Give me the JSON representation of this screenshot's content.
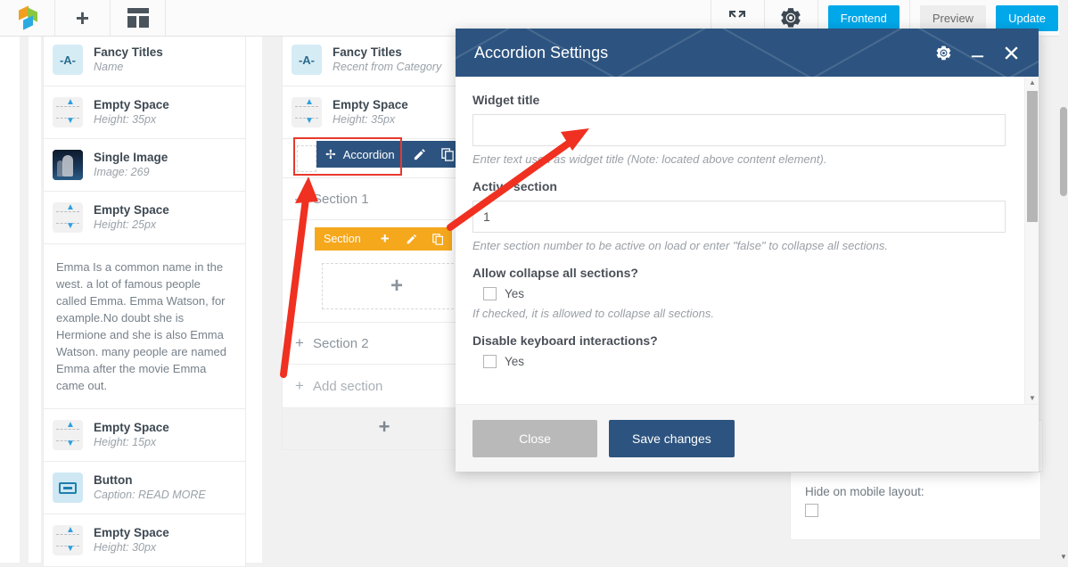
{
  "toolbar": {
    "logo_icon": "wpbakery-logo-icon",
    "add_element_icon": "plus-icon",
    "templates_icon": "layout-grid-icon",
    "fullscreen_icon": "expand-arrows-icon",
    "settings_icon": "gear-icon",
    "frontend_label": "Frontend",
    "preview_label": "Preview",
    "update_label": "Update",
    "accent_blue": "#00a8ea",
    "grey_button": "#ededed"
  },
  "left_column": {
    "elements": [
      {
        "icon": "fancy-titles-icon",
        "icon_text": "-A-",
        "title": "Fancy Titles",
        "subtitle": "Name"
      },
      {
        "icon": "empty-space-icon",
        "title": "Empty Space",
        "subtitle": "Height: 35px"
      },
      {
        "icon": "single-image-icon",
        "title": "Single Image",
        "subtitle": "Image: 269"
      },
      {
        "icon": "empty-space-icon",
        "title": "Empty Space",
        "subtitle": "Height: 25px"
      },
      {
        "icon": "text-block-icon",
        "title": "",
        "subtitle": "",
        "paragraph": "Emma Is a common name in the west. a lot of famous people called Emma. Emma Watson, for example.No doubt she is Hermione and she is also Emma Watson. many people are named Emma after the movie Emma came out."
      },
      {
        "icon": "empty-space-icon",
        "title": "Empty Space",
        "subtitle": "Height: 15px"
      },
      {
        "icon": "button-icon",
        "title": "Button",
        "subtitle": "Caption: READ MORE"
      },
      {
        "icon": "empty-space-icon",
        "title": "Empty Space",
        "subtitle": "Height: 30px"
      }
    ]
  },
  "middle_column": {
    "elements": [
      {
        "icon": "fancy-titles-icon",
        "icon_text": "-A-",
        "title": "Fancy Titles",
        "subtitle": "Recent from Category"
      },
      {
        "icon": "empty-space-icon",
        "title": "Empty Space",
        "subtitle": "Height: 35px"
      }
    ],
    "accordion": {
      "control_label": "Accordion",
      "move_icon": "move-arrows-icon",
      "edit_icon": "pencil-icon",
      "clone_icon": "copy-icon",
      "control_bar_color": "#2d5480",
      "highlight_color": "#e8392c",
      "section_1": {
        "toggle_sign": "—",
        "label": "Section 1",
        "control_label": "Section",
        "control_bar_color": "#f5a81c",
        "add_icon": "plus-icon",
        "edit_icon": "pencil-icon",
        "clone_icon": "copy-icon",
        "placeholder_icon": "plus-icon"
      },
      "section_2": {
        "toggle_sign": "+",
        "label": "Section 2"
      },
      "add_section": {
        "sign": "+",
        "label": "Add section"
      },
      "bottom_add_icon": "plus-icon"
    }
  },
  "right_panel": {
    "hide_on_mobile_label": "Hide on mobile layout:",
    "hide_on_mobile_checked": false
  },
  "modal": {
    "title": "Accordion Settings",
    "gear_icon": "gear-icon",
    "minimize_icon": "minimize-icon",
    "close_icon": "close-x-icon",
    "header_color": "#2d5480",
    "fields": [
      {
        "type": "text",
        "label": "Widget title",
        "value": "",
        "placeholder": "",
        "help": "Enter text used as widget title (Note: located above content element)."
      },
      {
        "type": "text",
        "label": "Active section",
        "value": "1",
        "placeholder": "",
        "help": "Enter section number to be active on load or enter \"false\" to collapse all sections."
      },
      {
        "type": "checkbox",
        "label": "Allow collapse all sections?",
        "option_label": "Yes",
        "checked": false,
        "help": "If checked, it is allowed to collapse all sections."
      },
      {
        "type": "checkbox",
        "label": "Disable keyboard interactions?",
        "option_label": "Yes",
        "checked": false,
        "help": ""
      }
    ],
    "footer": {
      "close_label": "Close",
      "save_label": "Save changes"
    },
    "scrollbar": {
      "up_arrow": "▲",
      "down_arrow": "▼"
    }
  },
  "annotations": {
    "arrow_color": "#f03020",
    "arrow_count": 2
  }
}
